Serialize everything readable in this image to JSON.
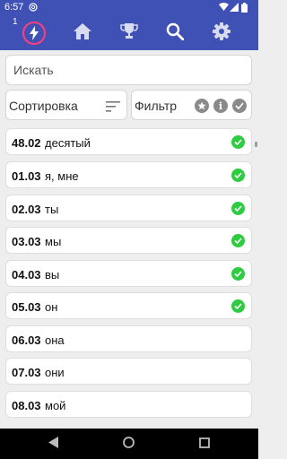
{
  "status_bar": {
    "time": "6:57"
  },
  "toolbar": {
    "badge": "1",
    "active_tab": "lightning"
  },
  "search": {
    "placeholder": "Искать",
    "value": ""
  },
  "sort": {
    "label": "Сортировка"
  },
  "filter": {
    "label": "Фильтр",
    "info_glyph": "i"
  },
  "words": [
    {
      "code": "48.02",
      "word": "десятый",
      "learned": true
    },
    {
      "code": "01.03",
      "word": "я, мне",
      "learned": true
    },
    {
      "code": "02.03",
      "word": "ты",
      "learned": true
    },
    {
      "code": "03.03",
      "word": "мы",
      "learned": true
    },
    {
      "code": "04.03",
      "word": "вы",
      "learned": true
    },
    {
      "code": "05.03",
      "word": "он",
      "learned": true
    },
    {
      "code": "06.03",
      "word": "она",
      "learned": false
    },
    {
      "code": "07.03",
      "word": "они",
      "learned": false
    },
    {
      "code": "08.03",
      "word": "мой",
      "learned": false
    }
  ],
  "colors": {
    "primary": "#3f51b5",
    "accent": "#ff3d7f",
    "learned": "#2ecc40"
  }
}
